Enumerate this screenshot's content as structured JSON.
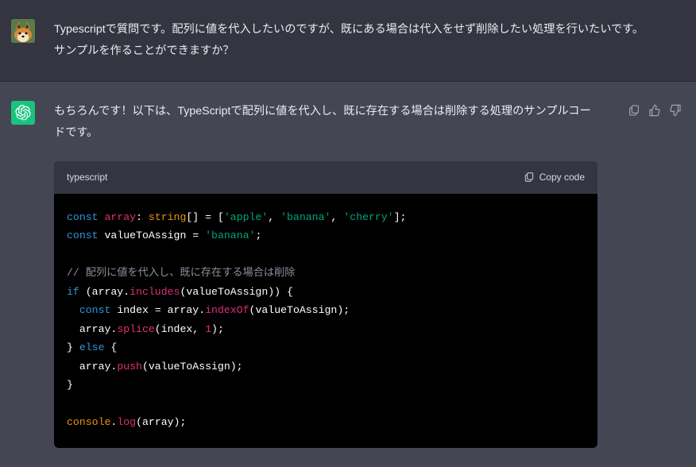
{
  "user": {
    "text": "Typescriptで質問です。配列に値を代入したいのですが、既にある場合は代入をせず削除したい処理を行いたいです。サンプルを作ることができますか？"
  },
  "assistant": {
    "intro": "もちろんです！以下は、TypeScriptで配列に値を代入し、既に存在する場合は削除する処理のサンプルコードです。",
    "code": {
      "lang": "typescript",
      "copy_label": "Copy code",
      "tokens": [
        [
          [
            "kw",
            "const"
          ],
          [
            "pun",
            " "
          ],
          [
            "var",
            "array"
          ],
          [
            "pun",
            ": "
          ],
          [
            "type",
            "string"
          ],
          [
            "pun",
            "[] = ["
          ],
          [
            "str",
            "'apple'"
          ],
          [
            "pun",
            ", "
          ],
          [
            "str",
            "'banana'"
          ],
          [
            "pun",
            ", "
          ],
          [
            "str",
            "'cherry'"
          ],
          [
            "pun",
            "];"
          ]
        ],
        [
          [
            "kw",
            "const"
          ],
          [
            "pun",
            " "
          ],
          [
            "id",
            "valueToAssign"
          ],
          [
            "pun",
            " = "
          ],
          [
            "str",
            "'banana'"
          ],
          [
            "pun",
            ";"
          ]
        ],
        [],
        [
          [
            "cmt",
            "// 配列に値を代入し、既に存在する場合は削除"
          ]
        ],
        [
          [
            "kw",
            "if"
          ],
          [
            "pun",
            " ("
          ],
          [
            "id",
            "array"
          ],
          [
            "pun",
            "."
          ],
          [
            "var",
            "includes"
          ],
          [
            "pun",
            "(valueToAssign)) {"
          ]
        ],
        [
          [
            "pun",
            "  "
          ],
          [
            "kw",
            "const"
          ],
          [
            "pun",
            " "
          ],
          [
            "id",
            "index"
          ],
          [
            "pun",
            " = array."
          ],
          [
            "var",
            "indexOf"
          ],
          [
            "pun",
            "(valueToAssign);"
          ]
        ],
        [
          [
            "pun",
            "  array."
          ],
          [
            "var",
            "splice"
          ],
          [
            "pun",
            "(index, "
          ],
          [
            "num",
            "1"
          ],
          [
            "pun",
            ");"
          ]
        ],
        [
          [
            "pun",
            "} "
          ],
          [
            "kw",
            "else"
          ],
          [
            "pun",
            " {"
          ]
        ],
        [
          [
            "pun",
            "  array."
          ],
          [
            "var",
            "push"
          ],
          [
            "pun",
            "(valueToAssign);"
          ]
        ],
        [
          [
            "pun",
            "}"
          ]
        ],
        [],
        [
          [
            "type",
            "console"
          ],
          [
            "pun",
            "."
          ],
          [
            "var",
            "log"
          ],
          [
            "pun",
            "(array);"
          ]
        ]
      ]
    }
  }
}
